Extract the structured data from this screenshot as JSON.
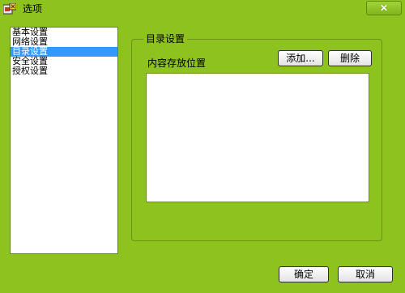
{
  "window": {
    "title": "选项",
    "app_icon": "app-icon",
    "close_label": "✕"
  },
  "nav": {
    "items": [
      {
        "label": "基本设置",
        "selected": false
      },
      {
        "label": "网络设置",
        "selected": false
      },
      {
        "label": "目录设置",
        "selected": true
      },
      {
        "label": "安全设置",
        "selected": false
      },
      {
        "label": "授权设置",
        "selected": false
      }
    ]
  },
  "directory": {
    "group_title": "目录设置",
    "storage_label": "内容存放位置",
    "add_label": "添加...",
    "delete_label": "删除",
    "paths": []
  },
  "footer": {
    "ok_label": "确定",
    "cancel_label": "取消"
  },
  "colors": {
    "background": "#8dc21f",
    "selection": "#3399ff"
  }
}
